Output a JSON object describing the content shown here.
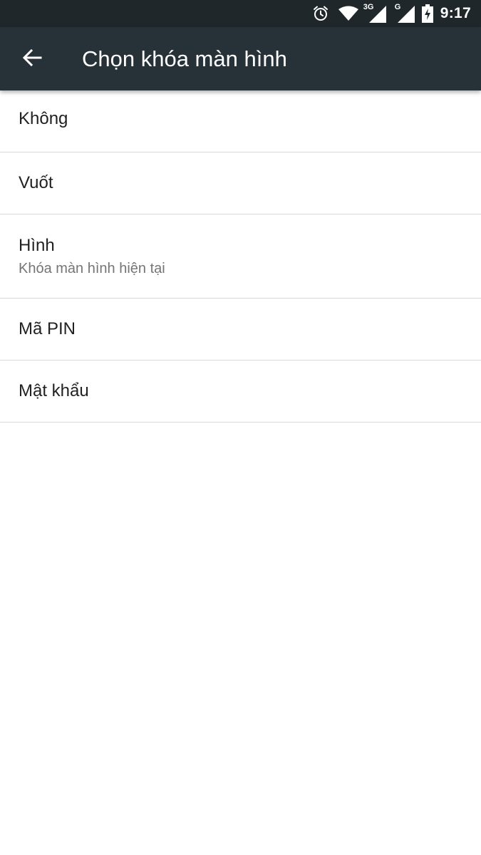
{
  "status_bar": {
    "time": "9:17",
    "icons": [
      "alarm-icon",
      "wifi-icon",
      "signal-3g-icon",
      "signal-g-icon",
      "battery-charging-icon"
    ],
    "network_3g_label": "3G",
    "network_g_label": "G"
  },
  "app_bar": {
    "title": "Chọn khóa màn hình",
    "back_icon": "arrow-back-icon",
    "background": "#263238"
  },
  "options": [
    {
      "label": "Không"
    },
    {
      "label": "Vuốt"
    },
    {
      "label": "Hình",
      "summary": "Khóa màn hình hiện tại"
    },
    {
      "label": "Mã PIN"
    },
    {
      "label": "Mật khẩu"
    }
  ]
}
